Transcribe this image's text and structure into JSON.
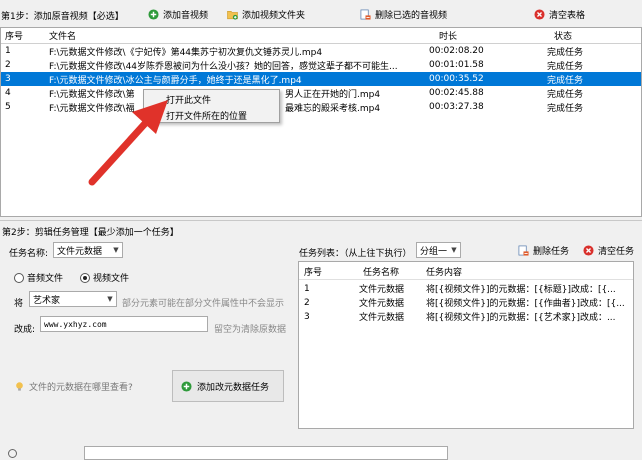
{
  "toolbar": {
    "step1_label": "第1步：添加原音视频【必选】",
    "add_video": "添加音视频",
    "add_folder": "添加视频文件夹",
    "delete_selected": "删除已选的音视频",
    "clear_table": "清空表格"
  },
  "file_table": {
    "headers": {
      "index": "序号",
      "filename": "文件名",
      "duration": "时长",
      "status": "状态"
    },
    "rows": [
      {
        "index": "1",
        "filename": "F:\\元数据文件修改\\《宁妃传》第44集苏宁初次复仇文锤苏灵儿.mp4",
        "duration": "00:02:08.20",
        "status": "完成任务"
      },
      {
        "index": "2",
        "filename": "F:\\元数据文件修改\\44岁陈乔恩被问为什么没小孩？她的回答，感觉这辈子都不可能生...",
        "duration": "00:01:01.58",
        "status": "完成任务"
      },
      {
        "index": "3",
        "filename": "F:\\元数据文件修改\\冰公主与颜爵分手，她终于还是黑化了.mp4",
        "duration": "00:00:35.52",
        "status": "完成任务"
      },
      {
        "index": "4",
        "filename": "F:\\元数据文件修改\\第",
        "filename_tail": "男人正在开她的门.mp4",
        "duration": "00:02:45.88",
        "status": "完成任务"
      },
      {
        "index": "5",
        "filename": "F:\\元数据文件修改\\福",
        "filename_tail": "最难忘的殿采考核.mp4",
        "duration": "00:03:27.38",
        "status": "完成任务"
      }
    ]
  },
  "context_menu": {
    "open_file": "打开此文件",
    "open_location": "打开文件所在的位置"
  },
  "step2": {
    "title": "第2步：剪辑任务管理【最少添加一个任务】",
    "task_name_label": "任务名称:",
    "task_name_value": "文件元数据",
    "radio_audio": "音频文件",
    "radio_video": "视频文件",
    "field_prefix": "将",
    "field_value": "艺术家",
    "field_hint": "部分元素可能在部分文件属性中不会显示",
    "change_label": "改成:",
    "change_value": "www.yxhyz.com",
    "change_hint": "留空为清除原数据",
    "help_link": "文件的元数据在哪里查看?",
    "add_task_button": "添加改元数据任务"
  },
  "task_list": {
    "label": "任务列表：（从上往下执行）",
    "group_value": "分组一",
    "delete_task": "删除任务",
    "clear_task": "清空任务",
    "headers": {
      "index": "序号",
      "name": "任务名称",
      "content": "任务内容"
    },
    "rows": [
      {
        "index": "1",
        "name": "文件元数据",
        "content": "将[{视频文件}]的元数据：[{标题}]改成：[{..."
      },
      {
        "index": "2",
        "name": "文件元数据",
        "content": "将[{视频文件}]的元数据：[{作曲者}]改成：[{..."
      },
      {
        "index": "3",
        "name": "文件元数据",
        "content": "将[{视频文件}]的元数据：[{艺术家}]改成：..."
      }
    ]
  },
  "colors": {
    "selection": "#0078d7",
    "arrow": "#e0322a",
    "green": "#2e9a3a",
    "red": "#d9302c"
  }
}
